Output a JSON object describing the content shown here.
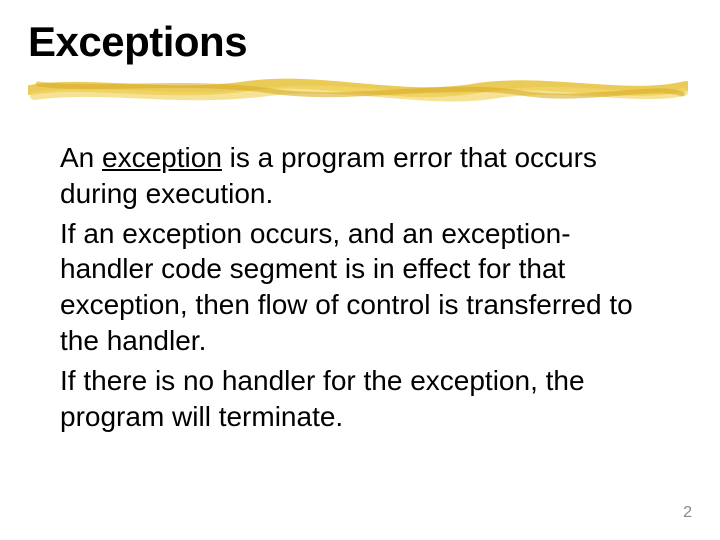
{
  "slide": {
    "title": "Exceptions",
    "paragraphs": {
      "p1_pre": "An ",
      "p1_u": "exception",
      "p1_post": " is a program error that occurs during execution.",
      "p2": "If an exception occurs, and an exception-handler code segment is in effect for that exception, then flow of control is transferred to the handler.",
      "p3": "If there is no handler for the exception, the program will terminate."
    },
    "page_number": "2"
  }
}
